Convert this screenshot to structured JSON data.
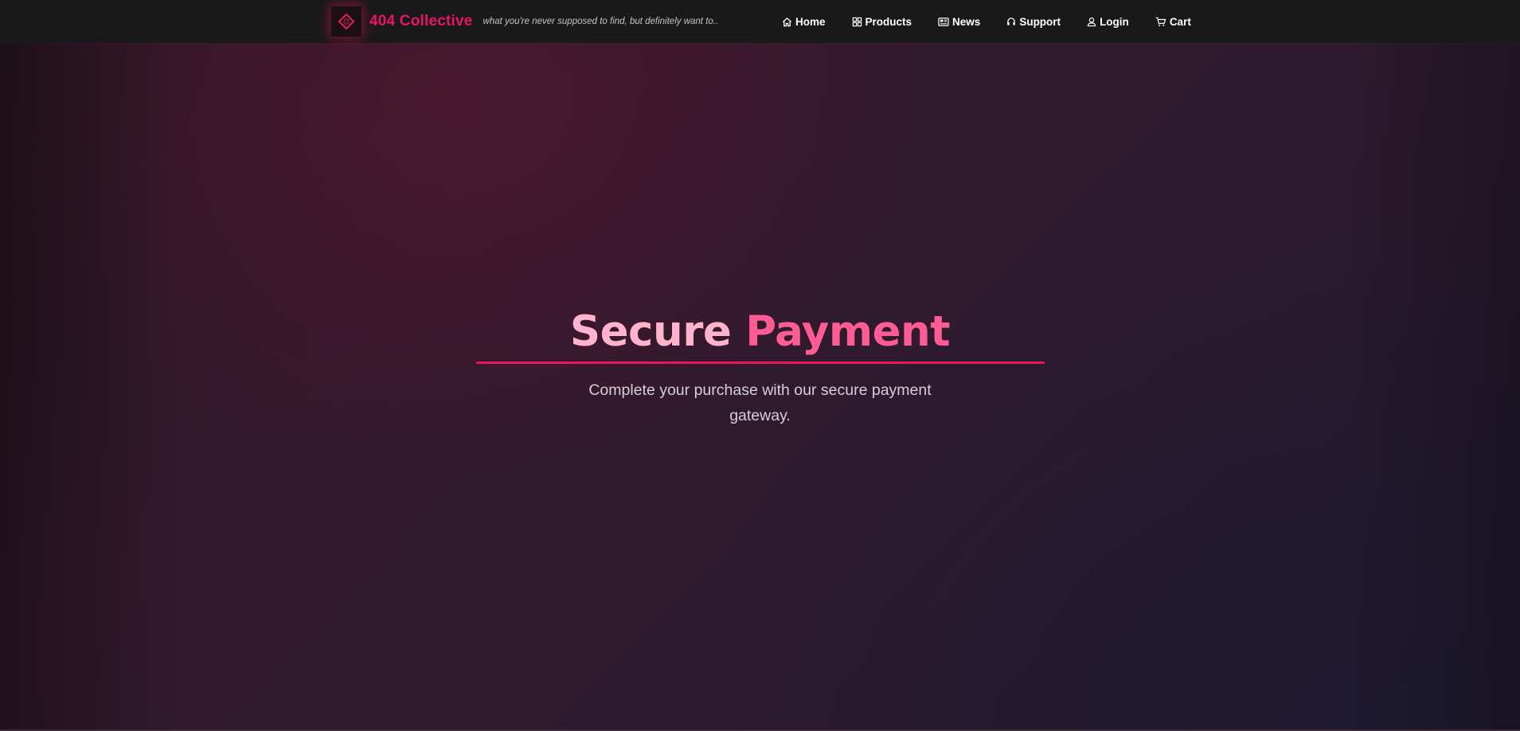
{
  "header": {
    "brand_name": "404 Collective",
    "tagline": "what you're never supposed to find, but definitely want to..",
    "logo_icon": "shield-diamond-icon",
    "accent_color": "#ea1466",
    "nav": [
      {
        "label": "Home",
        "icon": "home-icon"
      },
      {
        "label": "Products",
        "icon": "grid-icon"
      },
      {
        "label": "News",
        "icon": "newspaper-icon"
      },
      {
        "label": "Support",
        "icon": "headset-icon"
      },
      {
        "label": "Login",
        "icon": "user-icon"
      },
      {
        "label": "Cart",
        "icon": "cart-icon"
      }
    ]
  },
  "hero": {
    "title_word_1": "Secure",
    "title_word_2": "Payment",
    "subtitle": "Complete your purchase with our secure payment gateway."
  }
}
